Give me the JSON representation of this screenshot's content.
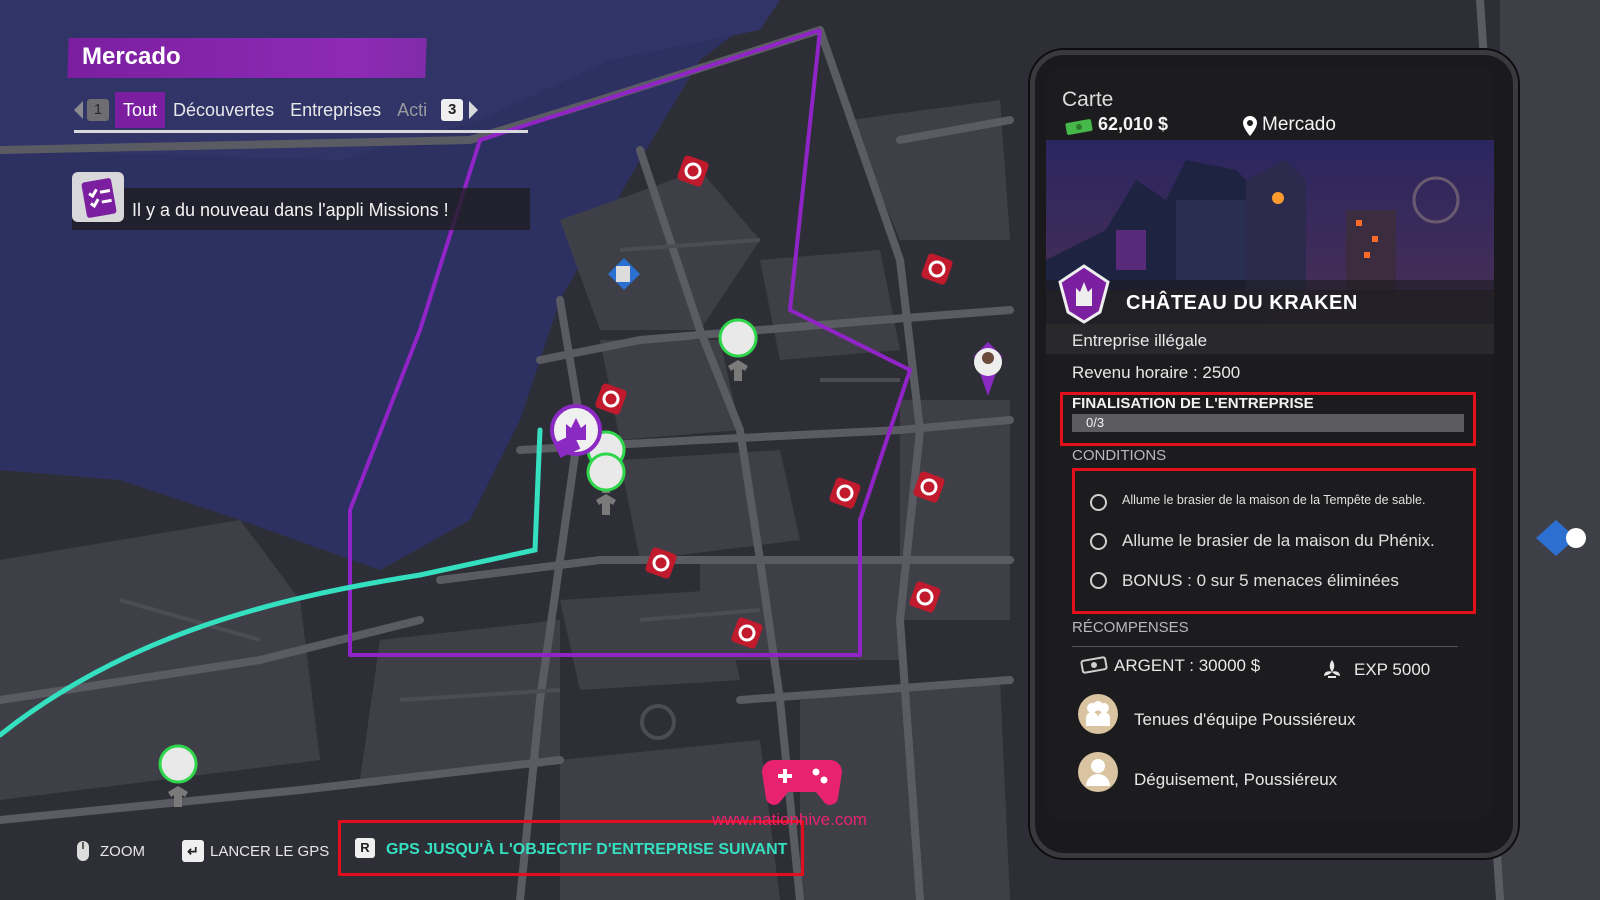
{
  "region": {
    "title": "Mercado"
  },
  "tabs": {
    "left_key": "1",
    "items": [
      {
        "label": "Tout",
        "active": true
      },
      {
        "label": "Découvertes",
        "active": false
      },
      {
        "label": "Entreprises",
        "active": false
      },
      {
        "label": "Acti",
        "active": false
      }
    ],
    "right_key": "3"
  },
  "notification": {
    "text": "Il y a du nouveau dans l'appli Missions !"
  },
  "card": {
    "header": "Carte",
    "money": "62,010 $",
    "location": "Mercado",
    "business_name": "CHÂTEAU DU KRAKEN",
    "business_type": "Entreprise illégale",
    "hourly_income": "Revenu horaire : 2500",
    "completion": {
      "label": "FINALISATION DE L'ENTREPRISE",
      "progress_text": "0/3",
      "progress_fraction": 0.0
    },
    "conditions_label": "CONDITIONS",
    "conditions": [
      "Allume le brasier de la maison de la Tempête de sable.",
      "Allume le brasier de la maison du Phénix.",
      "BONUS : 0 sur 5 menaces éliminées"
    ],
    "rewards_label": "RÉCOMPENSES",
    "rewards": {
      "money": "ARGENT : 30000 $",
      "exp": "EXP 5000",
      "items": [
        "Tenues d'équipe Poussiéreux",
        "Déguisement, Poussiéreux"
      ]
    }
  },
  "hints": {
    "zoom": "ZOOM",
    "launch_gps_key": "↵",
    "launch_gps": "LANCER LE GPS",
    "gps_next_key": "R",
    "gps_next": "GPS JUSQU'À L'OBJECTIF D'ENTREPRISE SUIVANT"
  },
  "watermark": {
    "text": "www.nationhive.com"
  },
  "colors": {
    "accent_purple": "#7b1fa0",
    "route_teal": "#34e0c0",
    "highlight_red": "#e3101b",
    "watermark_pink": "#e8226e"
  }
}
